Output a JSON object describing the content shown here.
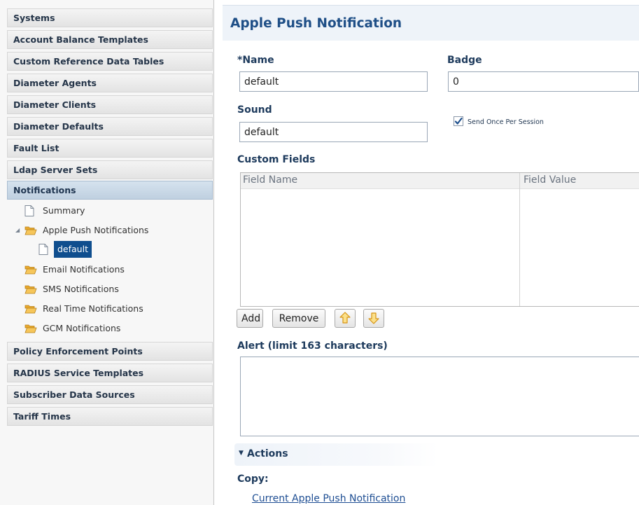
{
  "sidebar": {
    "sections": [
      {
        "label": "Systems"
      },
      {
        "label": "Account Balance Templates"
      },
      {
        "label": "Custom Reference Data Tables"
      },
      {
        "label": "Diameter Agents"
      },
      {
        "label": "Diameter Clients"
      },
      {
        "label": "Diameter Defaults"
      },
      {
        "label": "Fault List"
      },
      {
        "label": "Ldap Server Sets"
      },
      {
        "label": "Notifications"
      },
      {
        "label": "Policy Enforcement Points"
      },
      {
        "label": "RADIUS Service Templates"
      },
      {
        "label": "Subscriber Data Sources"
      },
      {
        "label": "Tariff Times"
      }
    ],
    "active_section": "Notifications",
    "tree": {
      "summary": "Summary",
      "apple_push": "Apple Push Notifications",
      "apple_default": "default",
      "email": "Email Notifications",
      "sms": "SMS Notifications",
      "realtime": "Real Time Notifications",
      "gcm": "GCM Notifications"
    }
  },
  "main": {
    "title": "Apple Push Notification",
    "name_label": "*Name",
    "name_value": "default",
    "badge_label": "Badge",
    "badge_value": "0",
    "sound_label": "Sound",
    "sound_value": "default",
    "send_once_label": "Send Once Per Session",
    "send_once_checked": true,
    "custom_fields_label": "Custom Fields",
    "columns": [
      "Field Name",
      "Field Value"
    ],
    "rows": [],
    "buttons": {
      "add": "Add",
      "remove": "Remove"
    },
    "alert_label": "Alert (limit 163 characters)",
    "alert_value": "",
    "actions_label": "Actions",
    "copy_label": "Copy:",
    "copy_link": "Current Apple Push Notification"
  },
  "colors": {
    "accent": "#1f4f87",
    "selected": "#0f4e8e",
    "folder": "#f0b43c",
    "arrow": "#e8a21e"
  }
}
